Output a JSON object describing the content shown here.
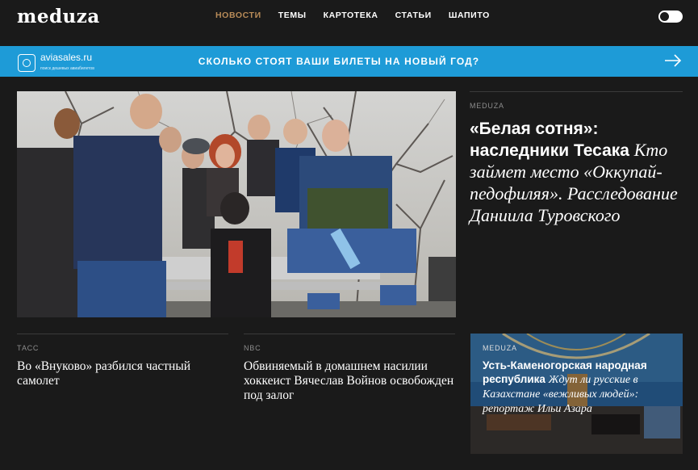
{
  "header": {
    "logo": "meduza",
    "nav": [
      {
        "label": "Новости",
        "active": true
      },
      {
        "label": "Темы",
        "active": false
      },
      {
        "label": "Картотека",
        "active": false
      },
      {
        "label": "Статьи",
        "active": false
      },
      {
        "label": "Шапито",
        "active": false
      }
    ],
    "theme_toggle": "dark-mode-toggle"
  },
  "banner": {
    "brand": "aviasales.ru",
    "brand_tagline": "поиск дешевых авиабилетов",
    "text": "Сколько стоят ваши билеты на Новый год?",
    "arrow_icon": "arrow-right-icon",
    "background": "#1e9bd7"
  },
  "feature": {
    "source": "MEDUZA",
    "title_bold": "«Белая сотня»: наследники Тесака",
    "title_italic": "Кто займет место «Оккупай-педофиляя». Расследование Даниила Туровского"
  },
  "cards": [
    {
      "source": "ТАСС",
      "title": "Во «Внуково» разбился частный самолет"
    },
    {
      "source": "NBC",
      "title": "Обвиняемый в домашнем насилии хоккеист Вячеслав Войнов освобожден под залог"
    }
  ],
  "photo_card": {
    "source": "MEDUZA",
    "title_bold": "Усть-Каменогорская народная республика",
    "title_italic": "Ждут ли русские в Казахстане «вежливых людей»: репортаж Ильи Азара"
  },
  "colors": {
    "background": "#1a1a1a",
    "accent": "#b88b58",
    "banner": "#1e9bd7"
  }
}
